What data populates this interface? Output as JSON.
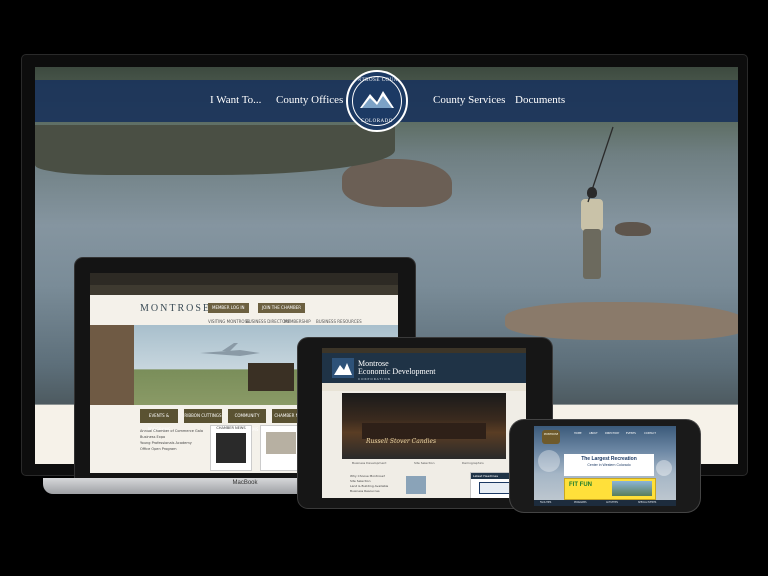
{
  "monitor": {
    "nav_left": [
      "I Want To...",
      "County Offices"
    ],
    "nav_right": [
      "County Services",
      "Documents"
    ],
    "logo": {
      "top_text": "MONTROSE COUNTY",
      "bottom_text": "COLORADO"
    }
  },
  "laptop": {
    "brand": "MacBook",
    "site_logo": "MONTROSE",
    "buttons": [
      "MEMBER LOG IN",
      "JOIN THE CHAMBER"
    ],
    "nav": [
      "VISITING MONTROSE",
      "BUSINESS DIRECTORY",
      "MEMBERSHIP",
      "BUSINESS RESOURCES"
    ],
    "tiles": [
      "EVENTS & PROGRAMS",
      "RIBBON CUTTINGS",
      "COMMUNITY PROGRAMS",
      "CHAMBER NEWS"
    ],
    "list": [
      "Annual Chamber of Commerce Gala",
      "Business Expo",
      "Young Professionals Academy",
      "Office Open Program"
    ],
    "card_title": "CHAMBER NEWS"
  },
  "tablet": {
    "title_line1": "Montrose",
    "title_line2": "Economic Development",
    "subtitle": "CORPORATION",
    "hero_caption": "Russell Stover Candies",
    "icons": [
      "Business Development",
      "Site Selection",
      "Demographics"
    ],
    "left_list": [
      "Why Choose Montrose?",
      "Site Selection",
      "Land & Building Available",
      "Business Resources"
    ],
    "box_title": "Latest Headlines"
  },
  "phone": {
    "logo_text": "MONTROSE",
    "nav": [
      "HOME",
      "ABOUT",
      "DIRECTORY",
      "EVENTS",
      "CONTACT"
    ],
    "banner_line1": "The Largest Recreation",
    "banner_line2": "Center in Western Colorado",
    "ad_text": "FIT FUN",
    "footer": [
      "FACILITIES",
      "PROGRAMS",
      "ACTIVITIES",
      "SPECIAL EVENTS"
    ]
  },
  "colors": {
    "header_blue": "#1b345b",
    "laptop_accent": "#5a5232",
    "tablet_navy": "#1f3346",
    "phone_ad": "#ffe03a"
  }
}
